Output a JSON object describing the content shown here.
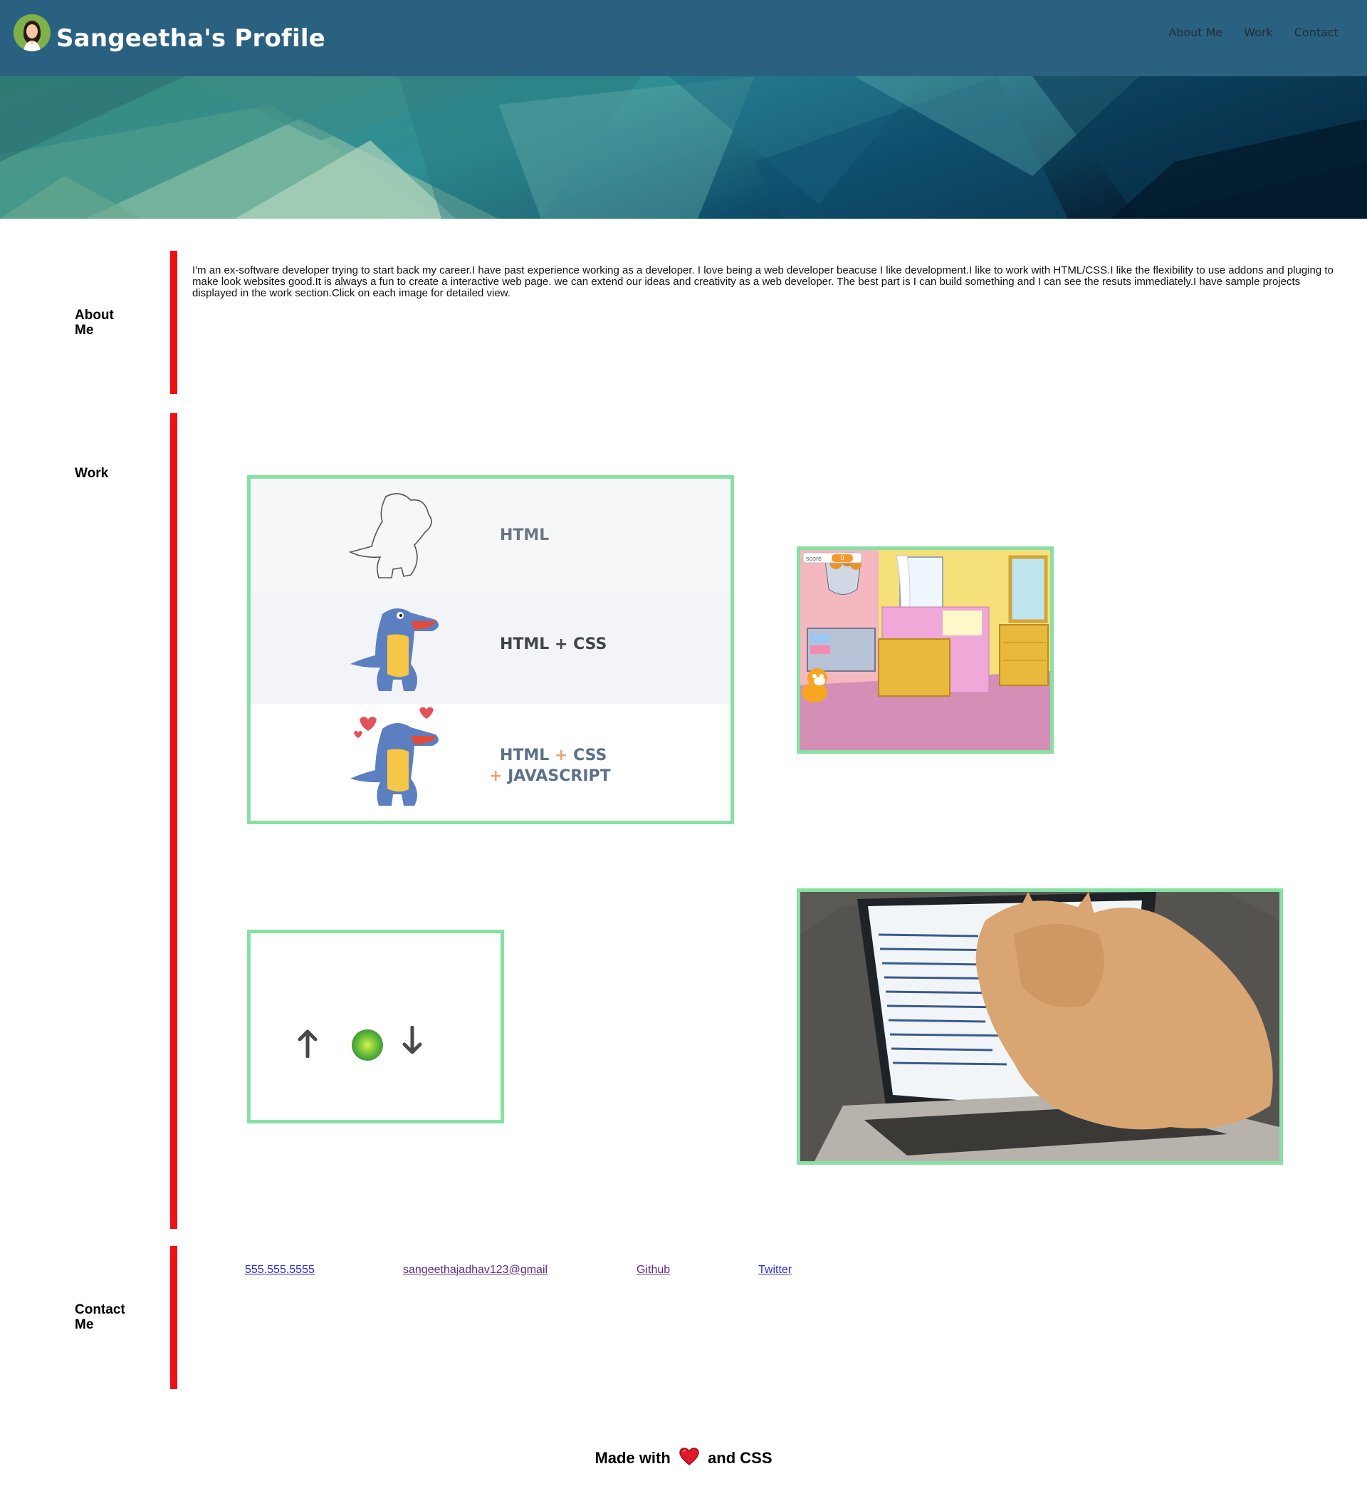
{
  "header": {
    "title": "Sangeetha's Profile",
    "nav": [
      {
        "label": "About Me"
      },
      {
        "label": "Work"
      },
      {
        "label": "Contact"
      }
    ],
    "bg_color": "#2b6180"
  },
  "about": {
    "heading": "About Me",
    "text": "I'm an ex-software developer trying to start back my career.I have past experience working as a developer. I love being a web developer beacuse I like development.I like to work with HTML/CSS.I like the flexibility to use addons and pluging to make look websites good.It is always a fun to create a interactive web page. we can extend our ideas and creativity as a web developer. The best part is I can build something and I can see the resuts immediately.I have sample projects displayed in the work section.Click on each image for detailed view."
  },
  "work": {
    "heading": "Work",
    "frame_color": "#88e0a3",
    "projects": [
      {
        "rows": [
          "HTML",
          "HTML + CSS",
          "HTML + CSS + JAVASCRIPT"
        ],
        "row_lines": [
          [
            "HTML"
          ],
          [
            "HTML + CSS"
          ],
          [
            "HTML",
            "+",
            "CSS"
          ],
          [
            "+",
            "JAVASCRIPT"
          ]
        ]
      },
      {
        "score_label": "score",
        "score_value": "0"
      },
      {
        "icons": [
          "arrow-up-icon",
          "green-ball-icon",
          "arrow-down-icon"
        ]
      },
      {
        "subject": "cat-on-laptop"
      }
    ]
  },
  "contact": {
    "heading": "Contact Me",
    "links": [
      {
        "label": "555.555.5555"
      },
      {
        "label": "sangeethajadhav123@gmail"
      },
      {
        "label": "Github"
      },
      {
        "label": "Twitter"
      }
    ]
  },
  "footer": {
    "made_with": "Made with",
    "and_css": "and CSS"
  },
  "accent_color": "#ee1111"
}
